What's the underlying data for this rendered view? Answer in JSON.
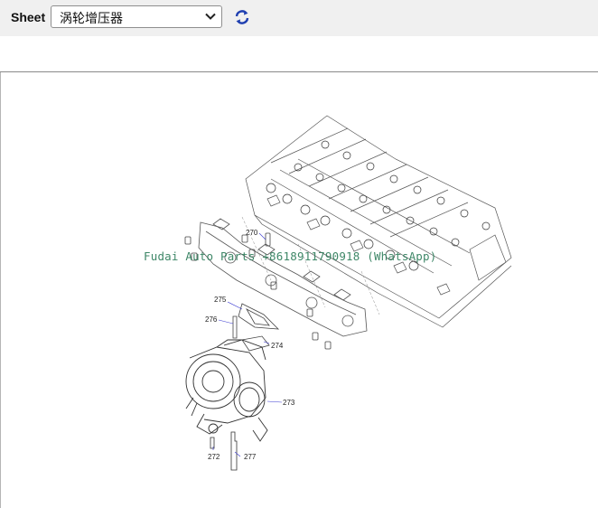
{
  "toolbar": {
    "sheet_label": "Sheet",
    "sheet_value": "涡轮增压器",
    "refresh_icon": "refresh-icon",
    "chevron_icon": "chevron-down-icon"
  },
  "diagram": {
    "callouts": [
      "270",
      "275",
      "276",
      "274",
      "273",
      "272",
      "277"
    ],
    "watermark": "Fudai Auto Parts +8618911790918 (WhatsApp)"
  }
}
